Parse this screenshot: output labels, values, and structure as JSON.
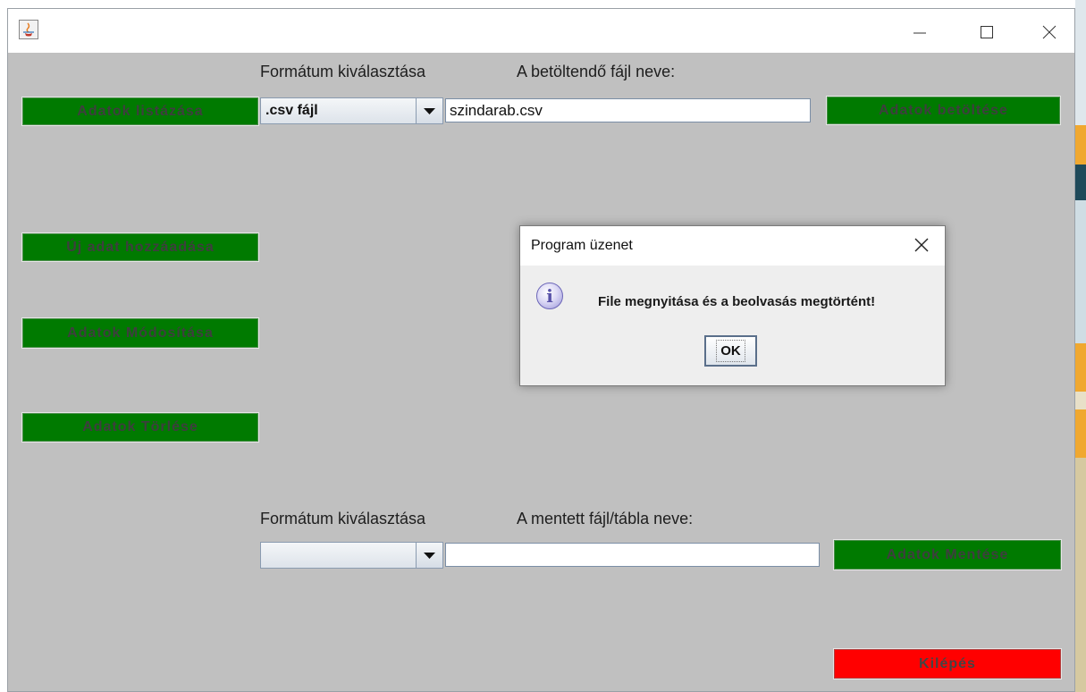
{
  "window": {
    "load_format_label": "Formátum kiválasztása",
    "load_file_label": "A betöltendő fájl neve:",
    "load_format_value": ".csv fájl",
    "load_file_value": "szindarab.csv",
    "save_format_label": "Formátum kiválasztása",
    "save_file_label": "A mentett fájl/tábla neve:",
    "save_format_value": "",
    "save_file_value": ""
  },
  "buttons": {
    "list": "Adatok listázása",
    "load": "Adatok betöltése",
    "add": "Új adat hozzáadása",
    "modify": "Adatok Módosítása",
    "delete": "Adatok Törlése",
    "save": "Adatok Mentése",
    "exit": "Kilépés"
  },
  "dialog": {
    "title": "Program üzenet",
    "message": "File megnyitása és a beolvasás megtörtént!",
    "ok_label": "OK",
    "icon": "info-icon"
  },
  "colors": {
    "button_green": "#007a00",
    "button_red": "#ff0000",
    "panel_bg": "#c0c0c0"
  }
}
